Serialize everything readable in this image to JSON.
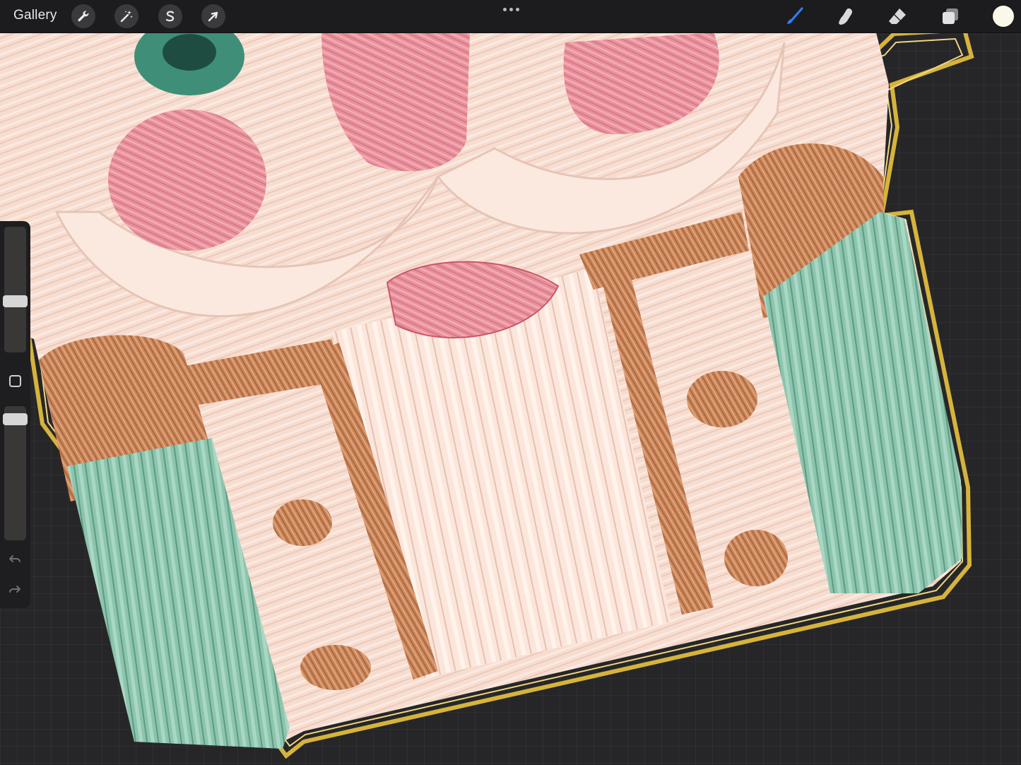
{
  "app": {
    "gallery_label": "Gallery"
  },
  "toolbar_left": {
    "tools": [
      {
        "name": "actions",
        "icon": "wrench-icon"
      },
      {
        "name": "adjustments",
        "icon": "magic-wand-icon"
      },
      {
        "name": "selection",
        "icon": "selection-s-icon"
      },
      {
        "name": "transform",
        "icon": "arrow-cursor-icon"
      }
    ]
  },
  "toolbar_right": {
    "tools": [
      {
        "name": "brush",
        "icon": "brush-icon",
        "active": true
      },
      {
        "name": "smudge",
        "icon": "smudge-finger-icon",
        "active": false
      },
      {
        "name": "eraser",
        "icon": "eraser-icon",
        "active": false
      },
      {
        "name": "layers",
        "icon": "layers-icon",
        "active": false
      }
    ],
    "current_color": "#fbf8ea"
  },
  "sidebar": {
    "brush_size_level": 0.55,
    "opacity_level": 1.0,
    "icons": [
      "modify-square-icon",
      "undo-icon",
      "redo-icon"
    ]
  },
  "colors": {
    "accent_blue": "#2f7df6",
    "toolbar_bg": "#1c1c1e",
    "canvas_bg": "#262628",
    "stitch_cream": "#f6d9cc",
    "stitch_pink": "#e98a97",
    "stitch_mint": "#8cc3ad",
    "stitch_copper": "#c98459",
    "gold_border": "#d6b43c"
  }
}
